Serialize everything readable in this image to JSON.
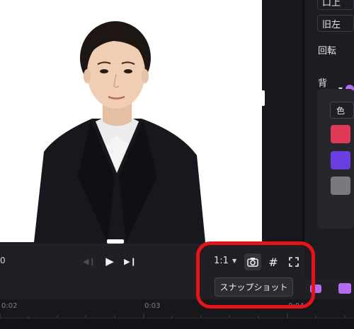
{
  "properties": {
    "align_top_label": "口上",
    "align_left_label": "旧左",
    "rotation_label": "回転",
    "background_label": "背景",
    "color_tab_label": "色",
    "swatches": [
      "#e03a58",
      "#6a3ee0",
      "#7a7a7e"
    ],
    "accent": "#b36cf2"
  },
  "preview": {
    "timecode": "0",
    "aspect_ratio": "1:1"
  },
  "tooltip": {
    "text": "スナップショット"
  },
  "timeline": {
    "ticks": [
      "0:02",
      "0:03",
      "0:04"
    ]
  },
  "annotation_color": "#e8121a"
}
